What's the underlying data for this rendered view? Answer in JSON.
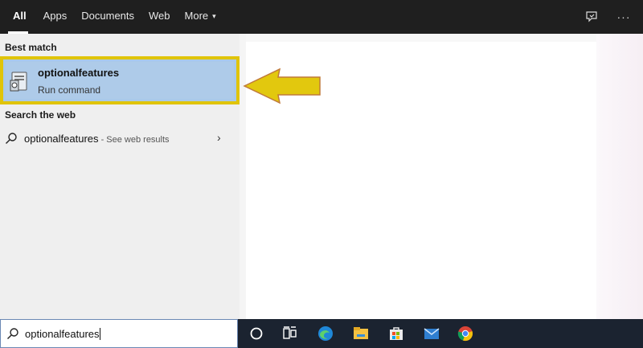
{
  "tabs": [
    {
      "label": "All",
      "active": true
    },
    {
      "label": "Apps"
    },
    {
      "label": "Documents"
    },
    {
      "label": "Web"
    },
    {
      "label": "More",
      "caret": "▾"
    }
  ],
  "top_icons": [
    "feedback-icon",
    "more-options-icon"
  ],
  "more_options_glyph": "···",
  "best_match": {
    "section_title": "Best match",
    "title": "optionalfeatures",
    "subtitle": "Run command",
    "icon": "run-command-icon",
    "highlight_color": "#e0c40a"
  },
  "web": {
    "section_title": "Search the web",
    "query": "optionalfeatures",
    "hint": " - See web results",
    "chevron": "›"
  },
  "search_box": {
    "value": "optionalfeatures"
  },
  "taskbar_icons": [
    "cortana-icon",
    "task-view-icon",
    "edge-icon",
    "file-explorer-icon",
    "store-icon",
    "mail-icon",
    "chrome-icon"
  ],
  "colors": {
    "topbar": "#1f1f1f",
    "taskbar": "#1b2330",
    "selection": "#aecbe9",
    "arrow": "#e2c80e"
  }
}
